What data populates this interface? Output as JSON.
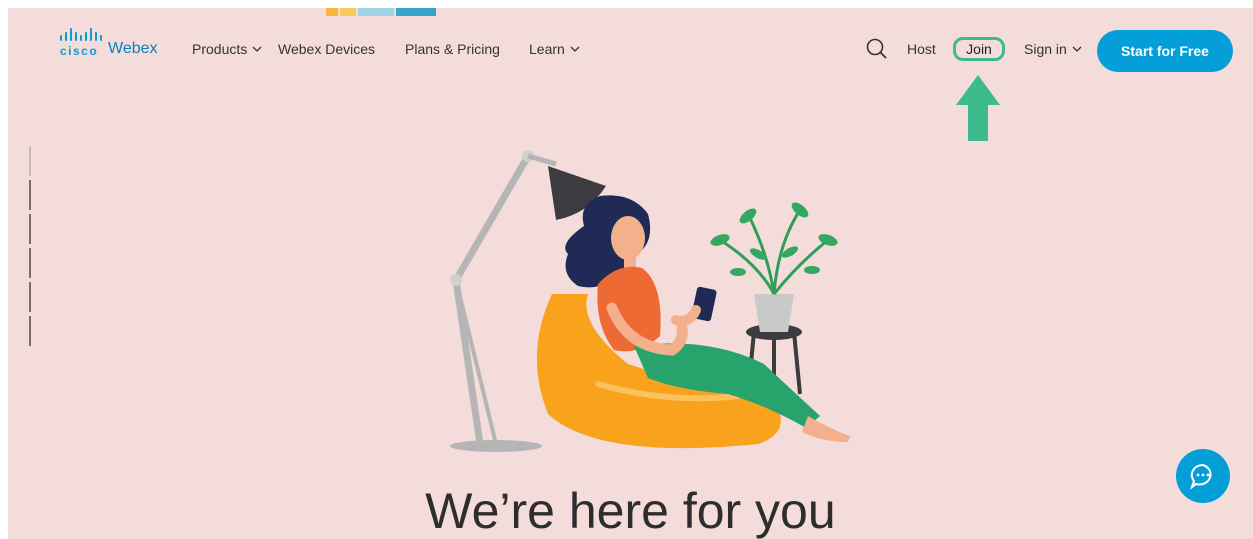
{
  "header": {
    "brand_primary": "cisco",
    "brand_secondary": "Webex",
    "nav": [
      {
        "label": "Products",
        "dropdown": true
      },
      {
        "label": "Webex Devices",
        "dropdown": false
      },
      {
        "label": "Plans & Pricing",
        "dropdown": false
      },
      {
        "label": "Learn",
        "dropdown": true
      }
    ],
    "right": {
      "search_icon": "search-icon",
      "host_label": "Host",
      "join_label": "Join",
      "signin_label": "Sign in",
      "cta_label": "Start for Free"
    }
  },
  "hero": {
    "headline": "We’re here for you",
    "illustration": "woman-on-beanbag-with-phone"
  },
  "annotation": {
    "arrow_icon": "green-up-arrow-icon",
    "highlight_color": "#3dbb8e"
  },
  "chat": {
    "icon": "chat-bubble-icon"
  },
  "colors": {
    "accent": "#049fd9",
    "background": "#f4dcda"
  }
}
